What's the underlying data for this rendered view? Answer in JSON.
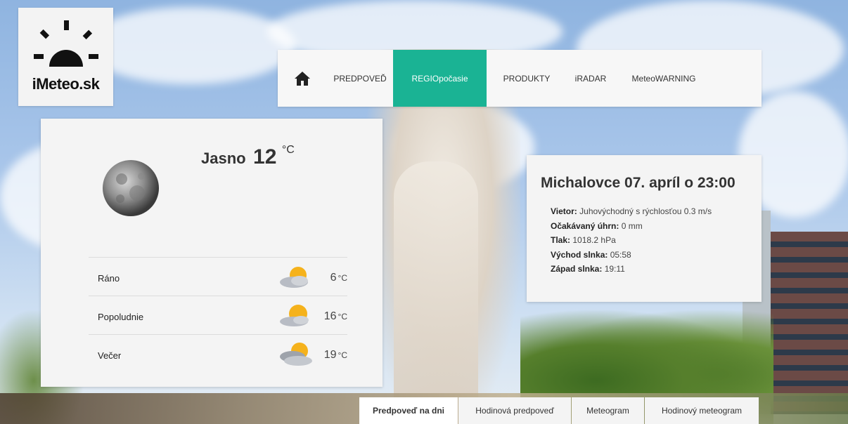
{
  "logo": {
    "text": "iMeteo.sk"
  },
  "nav": {
    "items": [
      {
        "label": "PREDPOVEĎ"
      },
      {
        "label": "REGIOpočasie",
        "active": true
      },
      {
        "label": "PRODUKTY"
      },
      {
        "label": "iRADAR"
      },
      {
        "label": "MeteoWARNING"
      }
    ],
    "accent": "#1ab394"
  },
  "current": {
    "condition": "Jasno",
    "temp": "12",
    "unit": "°C",
    "icon": "moon-icon"
  },
  "periods": [
    {
      "label": "Ráno",
      "temp": "6",
      "unit": "°C",
      "icon": "partly-cloudy-icon"
    },
    {
      "label": "Popoludnie",
      "temp": "16",
      "unit": "°C",
      "icon": "partly-cloudy-icon"
    },
    {
      "label": "Večer",
      "temp": "19",
      "unit": "°C",
      "icon": "cloudy-sun-icon"
    }
  ],
  "info": {
    "title": "Michalovce 07. apríl o 23:00",
    "wind_label": "Vietor:",
    "wind_value": "Juhovýchodný s rýchlosťou 0.3 m/s",
    "rain_label": "Očakávaný úhrn:",
    "rain_value": "0 mm",
    "pressure_label": "Tlak:",
    "pressure_value": "1018.2 hPa",
    "sunrise_label": "Východ slnka:",
    "sunrise_value": "05:58",
    "sunset_label": "Západ slnka:",
    "sunset_value": "19:11"
  },
  "tabs": [
    {
      "label": "Predpoveď na dni",
      "active": true
    },
    {
      "label": "Hodinová predpoveď"
    },
    {
      "label": "Meteogram"
    },
    {
      "label": "Hodinový meteogram"
    }
  ]
}
